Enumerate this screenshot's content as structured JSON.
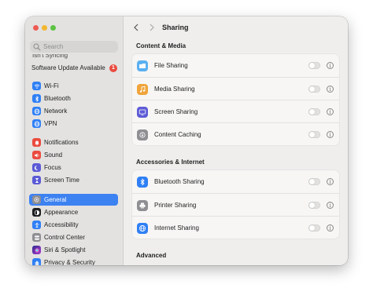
{
  "window": {
    "title": "Sharing"
  },
  "sidebar": {
    "search_placeholder": "Search",
    "cut_off_item": "Isn't Syncing",
    "software_update": {
      "label": "Software Update Available",
      "badge": "1"
    },
    "items": [
      {
        "label": "Wi-Fi",
        "icon": "wifi-icon",
        "color": "#2f7ff5"
      },
      {
        "label": "Bluetooth",
        "icon": "bluetooth-icon",
        "color": "#2f7ff5"
      },
      {
        "label": "Network",
        "icon": "globe-icon",
        "color": "#2f7ff5"
      },
      {
        "label": "VPN",
        "icon": "vpn-globe-icon",
        "color": "#2f7ff5"
      },
      {
        "label": "Notifications",
        "icon": "bell-icon",
        "color": "#eb4b3f"
      },
      {
        "label": "Sound",
        "icon": "speaker-icon",
        "color": "#eb4b3f"
      },
      {
        "label": "Focus",
        "icon": "moon-icon",
        "color": "#5b5ad6"
      },
      {
        "label": "Screen Time",
        "icon": "hourglass-icon",
        "color": "#5b5ad6"
      },
      {
        "label": "General",
        "icon": "gear-icon",
        "color": "#8e8e93",
        "selected": true
      },
      {
        "label": "Appearance",
        "icon": "appearance-icon",
        "color": "#1d1d1f"
      },
      {
        "label": "Accessibility",
        "icon": "accessibility-icon",
        "color": "#2f7ff5"
      },
      {
        "label": "Control Center",
        "icon": "control-center-icon",
        "color": "#8e8e93"
      },
      {
        "label": "Siri & Spotlight",
        "icon": "siri-icon",
        "color": "#6b3fd1"
      },
      {
        "label": "Privacy & Security",
        "icon": "hand-icon",
        "color": "#2f7ff5"
      }
    ]
  },
  "main": {
    "sections": [
      {
        "title": "Content & Media",
        "rows": [
          {
            "label": "File Sharing",
            "icon": "folder-icon",
            "color": "#5ab0f0"
          },
          {
            "label": "Media Sharing",
            "icon": "music-icon",
            "color": "#f0a43a"
          },
          {
            "label": "Screen Sharing",
            "icon": "screen-icon",
            "color": "#5e5bd6"
          },
          {
            "label": "Content Caching",
            "icon": "caching-icon",
            "color": "#8e8e93"
          }
        ]
      },
      {
        "title": "Accessories & Internet",
        "rows": [
          {
            "label": "Bluetooth Sharing",
            "icon": "bluetooth-icon",
            "color": "#2f7ff5"
          },
          {
            "label": "Printer Sharing",
            "icon": "printer-icon",
            "color": "#8e8e93"
          },
          {
            "label": "Internet Sharing",
            "icon": "globe-icon",
            "color": "#2f7ff5"
          }
        ]
      },
      {
        "title": "Advanced",
        "rows": []
      }
    ],
    "info_glyph": "i"
  }
}
